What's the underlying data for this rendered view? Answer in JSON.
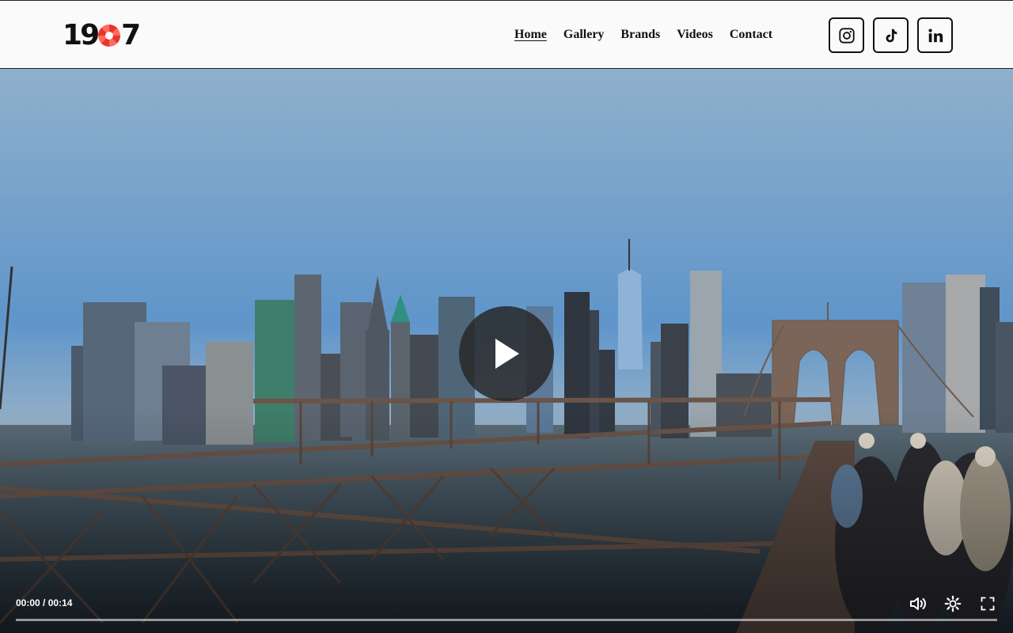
{
  "brand": {
    "logo_text": "1907"
  },
  "nav": {
    "items": [
      {
        "label": "Home",
        "active": true
      },
      {
        "label": "Gallery",
        "active": false
      },
      {
        "label": "Brands",
        "active": false
      },
      {
        "label": "Videos",
        "active": false
      },
      {
        "label": "Contact",
        "active": false
      }
    ]
  },
  "social": [
    {
      "icon": "instagram-icon"
    },
    {
      "icon": "tiktok-icon"
    },
    {
      "icon": "linkedin-icon"
    }
  ],
  "video": {
    "current_time": "00:00",
    "separator": "/",
    "duration": "00:14",
    "progress": 0,
    "controls": [
      "volume-icon",
      "settings-icon",
      "fullscreen-icon"
    ]
  },
  "colors": {
    "accent": "#e8342e",
    "text": "#111111",
    "header_bg": "#fafafa"
  }
}
